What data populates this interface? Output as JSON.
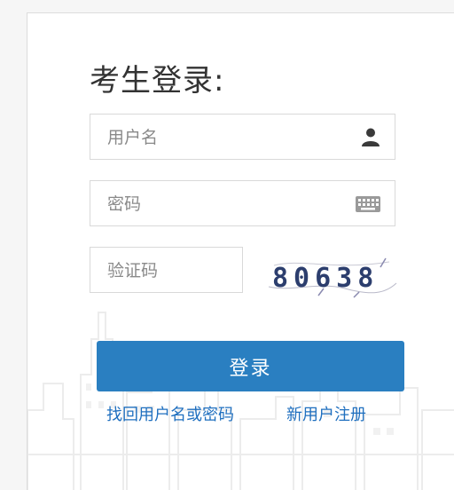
{
  "login": {
    "title": "考生登录:",
    "username_placeholder": "用户名",
    "password_placeholder": "密码",
    "captcha_placeholder": "验证码",
    "captcha_text": "80638",
    "submit_label": "登录",
    "recover_link": "找回用户名或密码",
    "register_link": "新用户注册"
  },
  "icons": {
    "username": "user-icon",
    "password": "keyboard-icon"
  },
  "colors": {
    "button": "#2a7fc1",
    "link": "#1f6fbf",
    "title": "#333333"
  }
}
